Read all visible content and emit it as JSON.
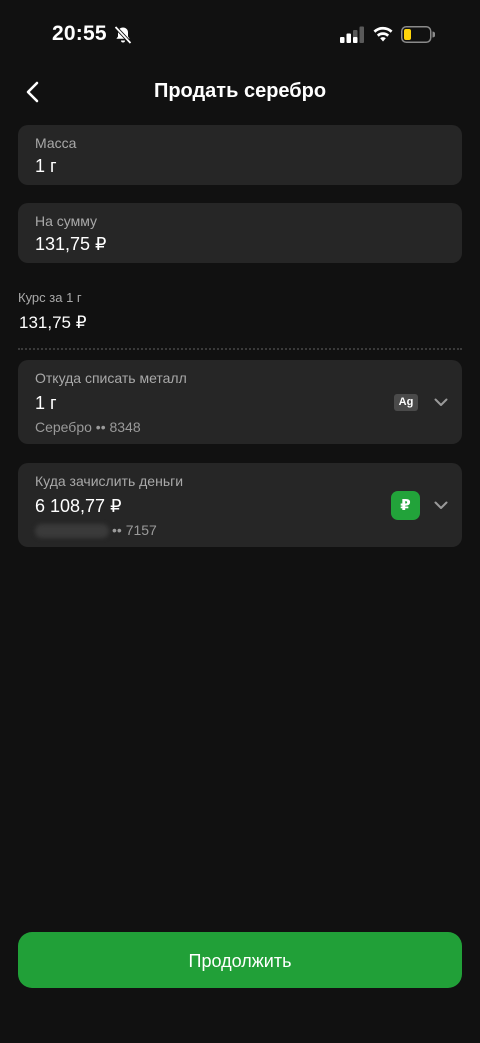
{
  "status_bar": {
    "time": "20:55"
  },
  "header": {
    "title": "Продать серебро"
  },
  "mass_field": {
    "label": "Масса",
    "value": "1 г"
  },
  "sum_field": {
    "label": "На сумму",
    "value": "131,75 ₽"
  },
  "rate": {
    "label": "Курс за 1 г",
    "value": "131,75 ₽"
  },
  "source_account": {
    "label": "Откуда списать металл",
    "amount": "1 г",
    "account_name": "Серебро",
    "account_mask": "•• 8348",
    "badge": "Ag"
  },
  "target_account": {
    "label": "Куда зачислить деньги",
    "amount": "6 108,77 ₽",
    "account_mask": "•• 7157",
    "badge": "₽"
  },
  "continue_button": {
    "label": "Продолжить"
  },
  "colors": {
    "background": "#111111",
    "card": "#262626",
    "accent_green": "#21a038",
    "muted_text": "#a9a9a9"
  },
  "icons": [
    "bell-off-icon",
    "signal-icon",
    "wifi-icon",
    "battery-icon",
    "back-arrow-icon",
    "chevron-down-icon"
  ]
}
